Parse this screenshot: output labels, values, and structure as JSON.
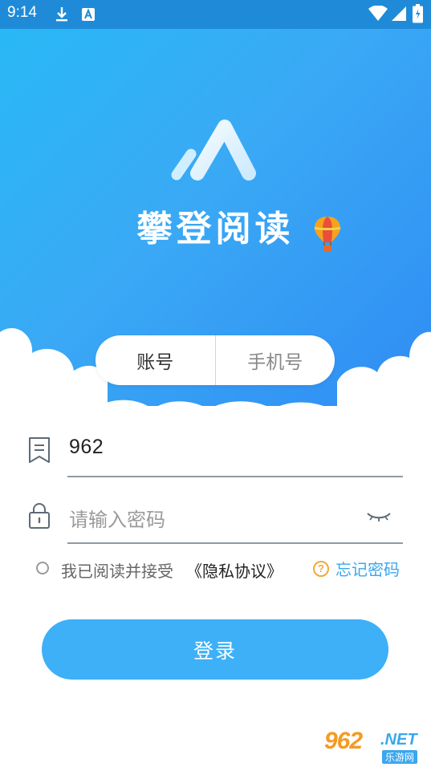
{
  "status_bar": {
    "time": "9:14",
    "left_icons": [
      "download-icon",
      "a-badge-icon"
    ],
    "right_icons": [
      "wifi-icon",
      "signal-icon",
      "battery-icon"
    ],
    "color": "#1f8bd8"
  },
  "hero": {
    "brand_name": "攀登阅读",
    "logo_icon": "mountain-logo-icon",
    "balloon_icon": "hot-air-balloon-icon",
    "gradient_colors": [
      "#29b8f6",
      "#2f8cf3"
    ]
  },
  "tabs": [
    {
      "label": "账号",
      "active": true
    },
    {
      "label": "手机号",
      "active": false
    }
  ],
  "form": {
    "account": {
      "icon": "bookmark-icon",
      "value": "962"
    },
    "password": {
      "icon": "lock-icon",
      "placeholder": "请输入密码",
      "toggle_icon": "eye-closed-icon"
    }
  },
  "agreement": {
    "checked": false,
    "text": "我已阅读并接受",
    "link": "《隐私协议》"
  },
  "forgot": {
    "icon": "question-circle-icon",
    "label": "忘记密码"
  },
  "login_button": {
    "label": "登录",
    "color": "#3db0f7"
  },
  "watermark": {
    "number": "962",
    "suffix": ".NET",
    "sub": "乐游网"
  },
  "accent_color": "#3aa7ee"
}
